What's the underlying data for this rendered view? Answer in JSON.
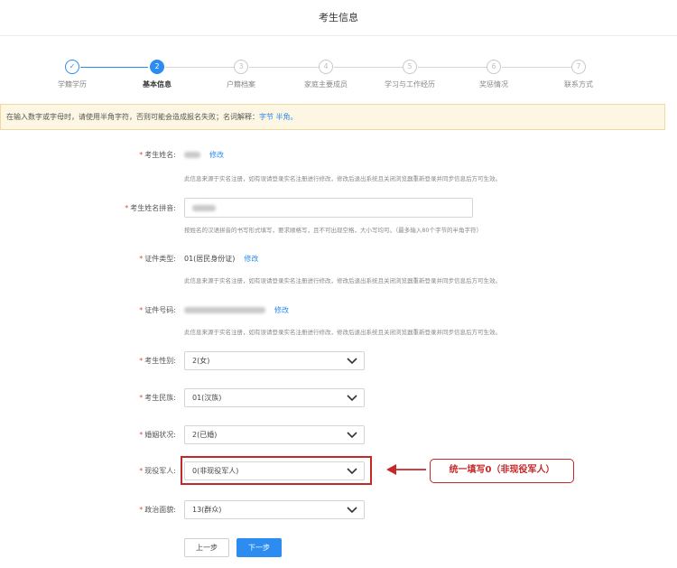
{
  "page": {
    "title": "考生信息"
  },
  "steps": [
    {
      "number": "✓",
      "label": "学籍学历",
      "state": "done"
    },
    {
      "number": "2",
      "label": "基本信息",
      "state": "active"
    },
    {
      "number": "3",
      "label": "户籍档案",
      "state": "pending"
    },
    {
      "number": "4",
      "label": "家庭主要成员",
      "state": "pending"
    },
    {
      "number": "5",
      "label": "学习与工作经历",
      "state": "pending"
    },
    {
      "number": "6",
      "label": "奖惩情况",
      "state": "pending"
    },
    {
      "number": "7",
      "label": "联系方式",
      "state": "pending"
    }
  ],
  "notice": {
    "text": "在输入数字或字母时，请使用半角字符，否则可能会造成报名失败；名词解释：",
    "link": "字节 半角。"
  },
  "form": {
    "required_mark": "*",
    "name": {
      "label": "考生姓名:",
      "edit": "修改",
      "hint": "此信息来源于实名注册，如有误请登录实名注册进行修改，修改后退出系统且关闭浏览器重新登录并同步信息后方可生效。"
    },
    "pinyin": {
      "label": "考生姓名拼音:",
      "hint": "按姓名的汉语拼音的书写形式填写，要求顺格写，且不可出现空格，大小写均可。（最多输入80个字节的半角字符）"
    },
    "id_type": {
      "label": "证件类型:",
      "value": "01(居民身份证)",
      "edit": "修改",
      "hint": "此信息来源于实名注册，如有误请登录实名注册进行修改，修改后退出系统且关闭浏览器重新登录并同步信息后方可生效。"
    },
    "id_number": {
      "label": "证件号码:",
      "edit": "修改",
      "hint": "此信息来源于实名注册，如有误请登录实名注册进行修改，修改后退出系统且关闭浏览器重新登录并同步信息后方可生效。"
    },
    "gender": {
      "label": "考生性别:",
      "value": "2(女)"
    },
    "ethnicity": {
      "label": "考生民族:",
      "value": "01(汉族)"
    },
    "marital": {
      "label": "婚姻状况:",
      "value": "2(已婚)"
    },
    "military": {
      "label": "现役军人:",
      "value": "0(非现役军人)"
    },
    "political": {
      "label": "政治面貌:",
      "value": "13(群众)"
    }
  },
  "annotation": {
    "text": "统一填写0（非现役军人）",
    "color": "#c62828"
  },
  "buttons": {
    "prev": "上一步",
    "next": "下一步"
  },
  "colors": {
    "primary": "#2d8cf0",
    "required": "#e64a4a",
    "notice_bg": "#fdf6e3"
  }
}
